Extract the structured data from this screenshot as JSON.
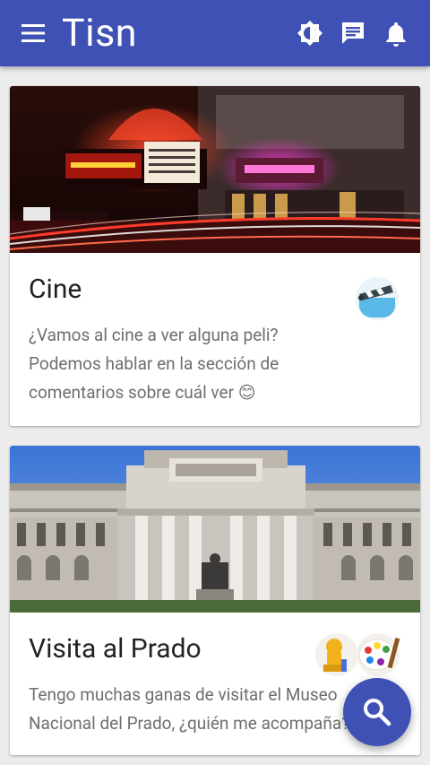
{
  "app": {
    "title": "Tisn",
    "colors": {
      "primary": "#3f51b5",
      "on_primary": "#ffffff",
      "background": "#ececec"
    },
    "actions": [
      "brightness-icon",
      "chat-icon",
      "bell-icon"
    ]
  },
  "cards": [
    {
      "title": "Cine",
      "description": "¿Vamos al cine a ver alguna peli? Podemos hablar en la sección de comentarios sobre cuál ver 😊",
      "image": "cinema-marquee-night-photo",
      "icon": "clapperboard-icon"
    },
    {
      "title": "Visita al Prado",
      "description": "Tengo muchas ganas de visitar el Museo Nacional del Prado, ¿quién me acompaña?",
      "image": "prado-museum-facade-photo",
      "icon": "art-bust-palette-icon"
    }
  ],
  "fab": {
    "icon": "search-icon"
  }
}
